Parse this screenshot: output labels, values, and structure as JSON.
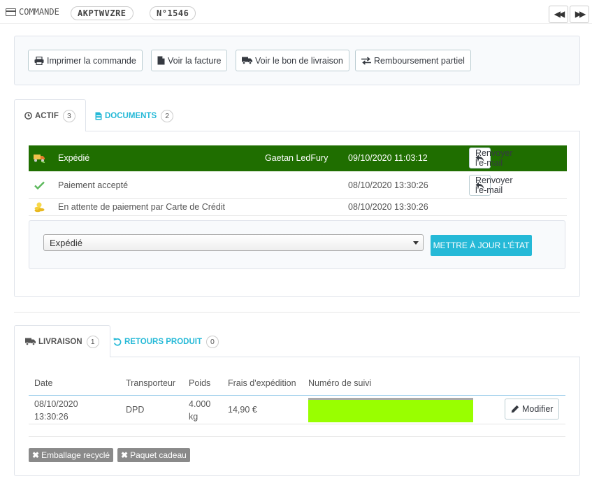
{
  "header": {
    "title": "COMMANDE",
    "reference": "AKPTWVZRE",
    "number": "N°1546"
  },
  "actions": {
    "print": "Imprimer la commande",
    "invoice": "Voir la facture",
    "delivery_slip": "Voir le bon de livraison",
    "partial_refund": "Remboursement partiel"
  },
  "status_tabs": {
    "active_label": "ACTIF",
    "active_count": "3",
    "documents_label": "DOCUMENTS",
    "documents_count": "2"
  },
  "history": [
    {
      "status": "Expédié",
      "employee": "Gaetan LedFury",
      "date": "09/10/2020 11:03:12",
      "resend": "Renvoyer l'e-mail"
    },
    {
      "status": "Paiement accepté",
      "employee": "",
      "date": "08/10/2020 13:30:26",
      "resend": "Renvoyer l'e-mail"
    },
    {
      "status": "En attente de paiement par Carte de Crédit",
      "employee": "",
      "date": "08/10/2020 13:30:26",
      "resend": ""
    }
  ],
  "status_update": {
    "selected": "Expédié",
    "button": "METTRE À JOUR L'ÉTAT"
  },
  "shipping_tabs": {
    "delivery_label": "LIVRAISON",
    "delivery_count": "1",
    "returns_label": "RETOURS PRODUIT",
    "returns_count": "0"
  },
  "shipping_table": {
    "headers": [
      "Date",
      "Transporteur",
      "Poids",
      "Frais d'expédition",
      "Numéro de suivi"
    ],
    "row": {
      "date_line1": "08/10/2020",
      "date_line2": "13:30:26",
      "carrier": "DPD",
      "weight_line1": "4.000",
      "weight_line2": "kg",
      "cost": "14,90 €",
      "edit": "Modifier"
    }
  },
  "tags": {
    "recycled": "Emballage recyclé",
    "gift": "Paquet cadeau"
  },
  "colors": {
    "accent": "#25b9d7",
    "current_status": "#1f6e00",
    "tracking_highlight": "#99ff00"
  }
}
